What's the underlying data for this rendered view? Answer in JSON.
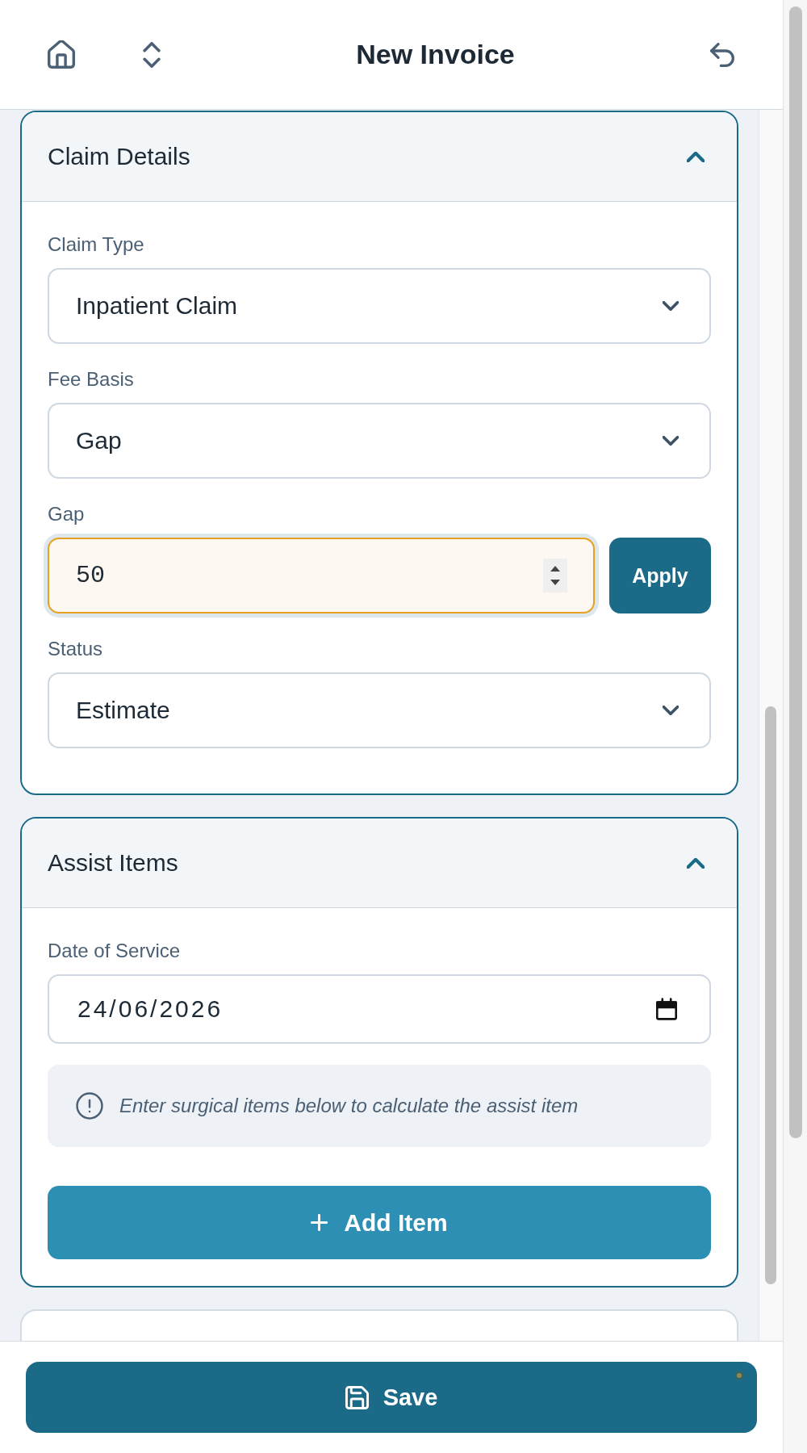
{
  "header": {
    "title": "New Invoice"
  },
  "sections": [
    {
      "title": "Claim Details",
      "expanded": true,
      "fields": [
        {
          "kind": "select",
          "label": "Claim Type",
          "value": "Inpatient Claim"
        },
        {
          "kind": "select",
          "label": "Fee Basis",
          "value": "Gap"
        },
        {
          "kind": "number",
          "label": "Gap",
          "value": "50",
          "focused": true,
          "button": "Apply"
        },
        {
          "kind": "select",
          "label": "Status",
          "value": "Estimate"
        }
      ]
    },
    {
      "title": "Assist Items",
      "expanded": true,
      "fields": [
        {
          "kind": "date",
          "label": "Date of Service",
          "value": "24/06/2026"
        },
        {
          "kind": "info",
          "text": "Enter surgical items below to calculate the assist item"
        },
        {
          "kind": "add_button",
          "label": "Add Item"
        }
      ]
    }
  ],
  "save_button": {
    "label": "Save"
  }
}
